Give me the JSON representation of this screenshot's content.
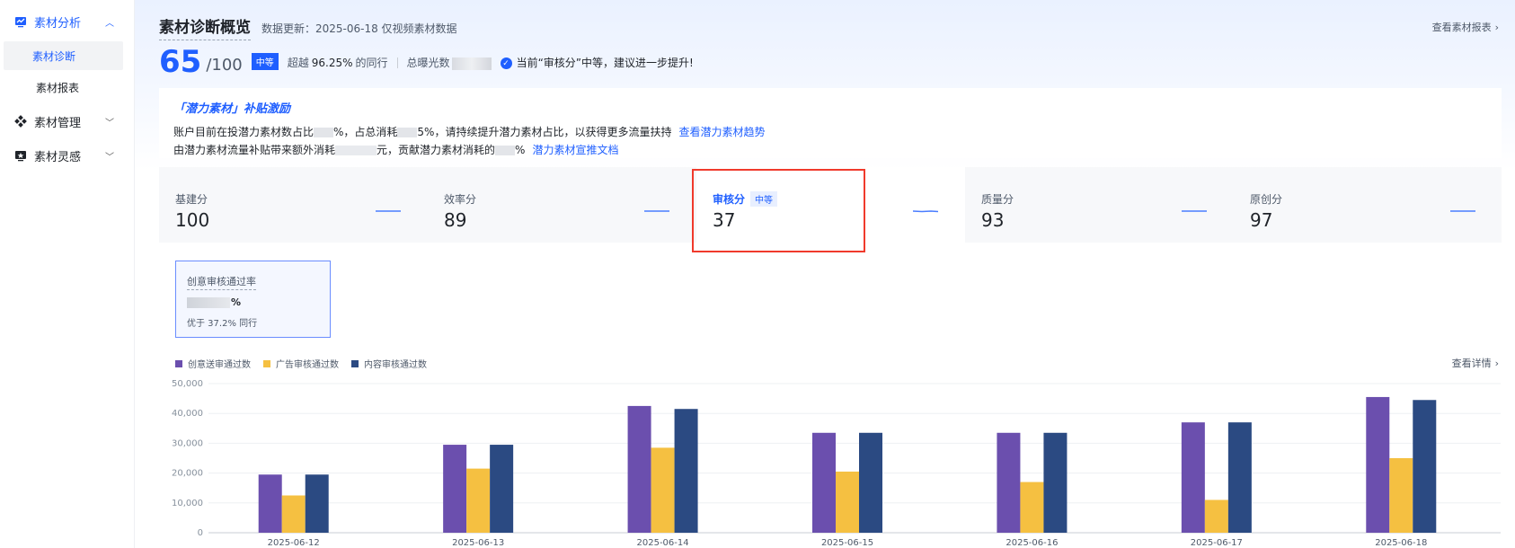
{
  "sidebar": {
    "groups": [
      {
        "label": "素材分析",
        "icon": "analysis-icon",
        "expanded": true,
        "active": true
      },
      {
        "label": "素材管理",
        "icon": "manage-icon",
        "expanded": false
      },
      {
        "label": "素材灵感",
        "icon": "inspiration-icon",
        "expanded": false
      }
    ],
    "sub_items": [
      {
        "label": "素材诊断",
        "active": true
      },
      {
        "label": "素材报表"
      }
    ]
  },
  "header": {
    "title": "素材诊断概览",
    "update_text": "数据更新：2025-06-18 仅视频素材数据",
    "report_link": "查看素材报表"
  },
  "score": {
    "value": "65",
    "denominator": "/100",
    "level_badge": "中等",
    "exceed_prefix": "超越",
    "exceed_value": "96.25%",
    "exceed_suffix": "的同行",
    "exposure_label": "总曝光数",
    "tip": "当前“审核分”中等，建议进一步提升!"
  },
  "incentive": {
    "title": "「潜力素材」补贴激励",
    "line1_a": "账户目前在投潜力素材数占比",
    "line1_b": "%，占总消耗",
    "line1_c": "5%，请持续提升潜力素材占比，以获得更多流量扶持",
    "line1_link": "查看潜力素材趋势",
    "line2_a": "由潜力素材流量补贴带来额外消耗",
    "line2_b": "元，贡献潜力素材消耗的",
    "line2_c": "%",
    "line2_link": "潜力素材宣推文档"
  },
  "score_cards": [
    {
      "label": "基建分",
      "value": "100"
    },
    {
      "label": "效率分",
      "value": "89"
    },
    {
      "label": "审核分",
      "value": "37",
      "badge": "中等",
      "active": true
    },
    {
      "label": "质量分",
      "value": "93"
    },
    {
      "label": "原创分",
      "value": "97"
    }
  ],
  "pass_card": {
    "title": "创意审核通过率",
    "value_suffix": "%",
    "sub": "优于 37.2% 同行"
  },
  "detail_link": "查看详情",
  "colors": {
    "accent": "#1f5fff",
    "highlight_box": "#f03a2c",
    "series1": "#6b4fae",
    "series2": "#f5c041",
    "series3": "#2b4a82"
  },
  "chart_data": {
    "type": "bar",
    "categories": [
      "2025-06-12",
      "2025-06-13",
      "2025-06-14",
      "2025-06-15",
      "2025-06-16",
      "2025-06-17",
      "2025-06-18"
    ],
    "series": [
      {
        "name": "创意送审通过数",
        "values": [
          19500,
          29500,
          42500,
          33500,
          33500,
          37000,
          45500
        ]
      },
      {
        "name": "广告审核通过数",
        "values": [
          12500,
          21500,
          28500,
          20500,
          17000,
          11000,
          25000
        ]
      },
      {
        "name": "内容审核通过数",
        "values": [
          19500,
          29500,
          41500,
          33500,
          33500,
          37000,
          44500
        ]
      }
    ],
    "y_ticks": [
      "0",
      "10,000",
      "20,000",
      "30,000",
      "40,000",
      "50,000"
    ],
    "ylim": [
      0,
      50000
    ],
    "legend_position": "top-left"
  }
}
